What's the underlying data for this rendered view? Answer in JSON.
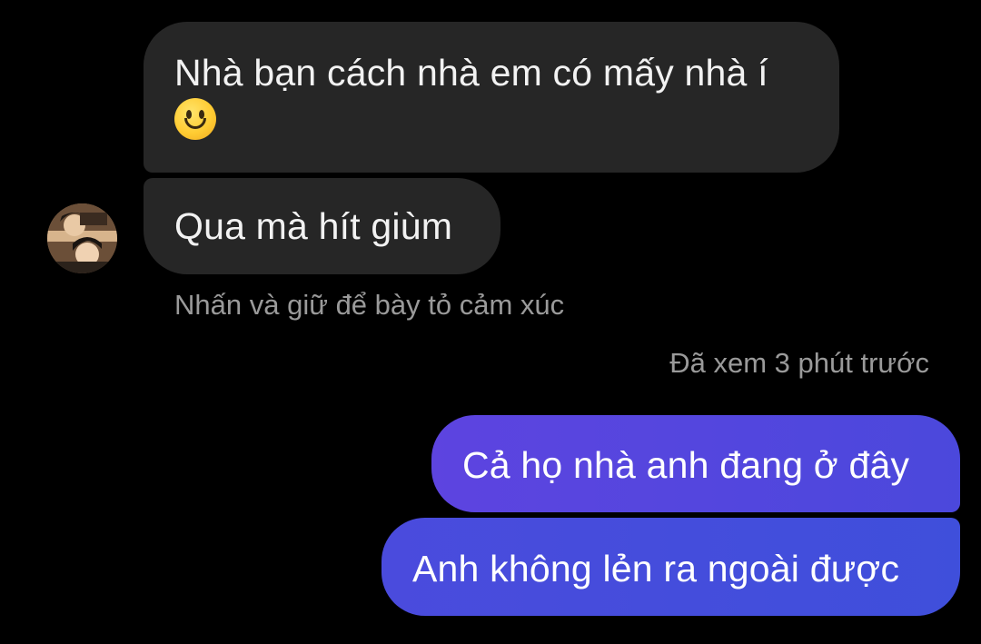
{
  "conversation": {
    "incoming_messages": [
      {
        "text": "Nhà bạn cách nhà em có mấy nhà í"
      },
      {
        "text": "Qua mà hít giùm"
      }
    ],
    "reaction_hint": "Nhấn và giữ để bày tỏ cảm xúc",
    "seen_status": "Đã xem 3 phút trước",
    "outgoing_messages": [
      {
        "text": "Cả họ nhà anh đang ở đây"
      },
      {
        "text": "Anh không lẻn ra ngoài được"
      }
    ],
    "emoji_icon": "slightly-smiling-face",
    "colors": {
      "background": "#000000",
      "incoming_bubble": "#262626",
      "outgoing_bubble": "#5346df",
      "meta_text": "#9a9a9a"
    }
  }
}
